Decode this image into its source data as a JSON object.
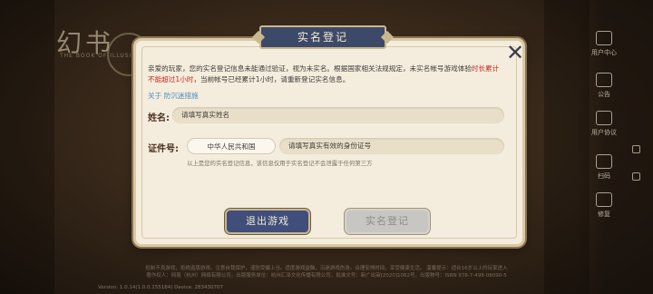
{
  "background": {
    "logo_text": "幻书",
    "logo_subtitle": "THE BOOK OF ILLUSION"
  },
  "right_menu": {
    "items": [
      {
        "label": "用户中心",
        "icon": "user-icon"
      },
      {
        "label": "公告",
        "icon": "notice-icon"
      },
      {
        "label": "用户协议",
        "icon": "document-icon"
      },
      {
        "label": "扫码",
        "icon": "scan-icon"
      },
      {
        "label": "修复",
        "icon": "wrench-icon"
      }
    ]
  },
  "dialog": {
    "title": "实名登记",
    "close_icon": "close-icon",
    "notice_part1": "亲爱的玩家，您的实名登记信息未能通过验证，视为未实名。根据国家相关法规规定，未实名帐号游戏体验",
    "notice_highlight": "时长累计不能超过1小时",
    "notice_part2": "，当前帐号已经累计1小时，请重新登记实名信息。",
    "anti_addiction_link": "关于 防沉迷措施",
    "name_label": "姓名:",
    "name_placeholder": "请填写真实姓名",
    "id_label": "证件号:",
    "country_value": "中华人民共和国",
    "id_placeholder": "请填写真实有效的身份证号",
    "hint": "以上是您的实名登记信息，该信息仅用于实名登记不会泄露于任何第三方",
    "exit_button": "退出游戏",
    "submit_button": "实名登记"
  },
  "footer": {
    "line1": "抵制不良游戏，拒绝盗版游戏。注意自我保护，谨防受骗上当。适度游戏益脑，沉迷游戏伤身。合理安排时间，享受健康生活。 温馨提示：适合16岁以上的玩家进入",
    "line2": "著作权人：网易（杭州）网络有限公司，出版服务单位：杭州汇泽文化传播有限公司，批准文号：新广出审[2020]1062号，出版物号：ISBN 978-7-498-08090-5",
    "version": "Version: 1.0.14(1.0.0.155184) Device: 283430707"
  },
  "colors": {
    "dialog_bg": "#f4ecdc",
    "title_bg": "#3d4968",
    "highlight_red": "#c82a22",
    "link_blue": "#4a8fbf",
    "exit_button_bg": "#3f4e7a",
    "submit_disabled_bg": "#c8c6c2"
  }
}
